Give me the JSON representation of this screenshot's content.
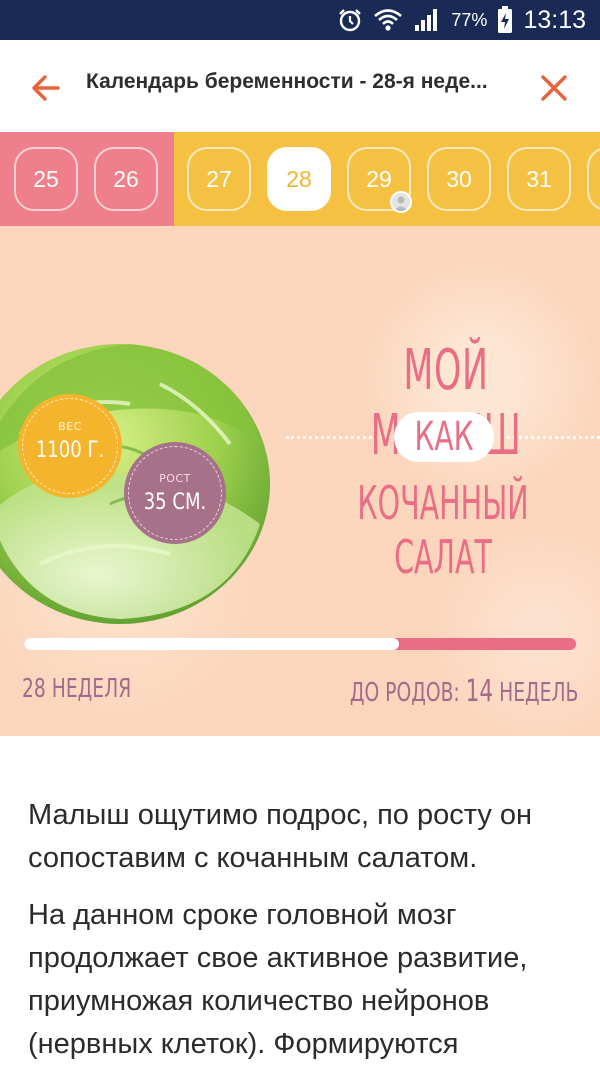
{
  "status_bar": {
    "battery_percent": "77%",
    "time": "13:13",
    "icons": [
      "alarm-icon",
      "wifi-icon",
      "signal-icon",
      "battery-charging-icon"
    ]
  },
  "app_bar": {
    "title": "Календарь беременности - 28-я неде...",
    "back_icon": "arrow-left-icon",
    "close_icon": "close-icon",
    "accent_color": "#e8623a"
  },
  "week_strip": {
    "weeks": [
      {
        "label": "25",
        "state": "past"
      },
      {
        "label": "26",
        "state": "past"
      },
      {
        "label": "27",
        "state": "future"
      },
      {
        "label": "28",
        "state": "current"
      },
      {
        "label": "29",
        "state": "future",
        "has_avatar": true
      },
      {
        "label": "30",
        "state": "future"
      },
      {
        "label": "31",
        "state": "future"
      }
    ],
    "past_color": "#ef7f8a",
    "future_color": "#f5c143"
  },
  "hero": {
    "weight_label": "ВЕС",
    "weight_value": "1100 Г.",
    "height_label": "РОСТ",
    "height_value": "35 СМ.",
    "headline_line1": "МОЙ МАЛЫШ",
    "headline_line2": "КАК",
    "headline_line3": "КОЧАННЫЙ САЛАТ",
    "week_label": "28 НЕДЕЛЯ",
    "remaining_prefix": "ДО РОДОВ: ",
    "remaining_value": "14",
    "remaining_suffix": " НЕДЕЛЬ",
    "progress_fraction": 0.68,
    "fruit_icon": "lettuce-icon"
  },
  "article": {
    "paragraph1": "Малыш ощутимо подрос, по росту он сопоставим с кочанным салатом.",
    "paragraph2": "На данном сроке головной мозг продолжает свое активное развитие, приумножая количество нейронов (нервных клеток). Формируются"
  }
}
